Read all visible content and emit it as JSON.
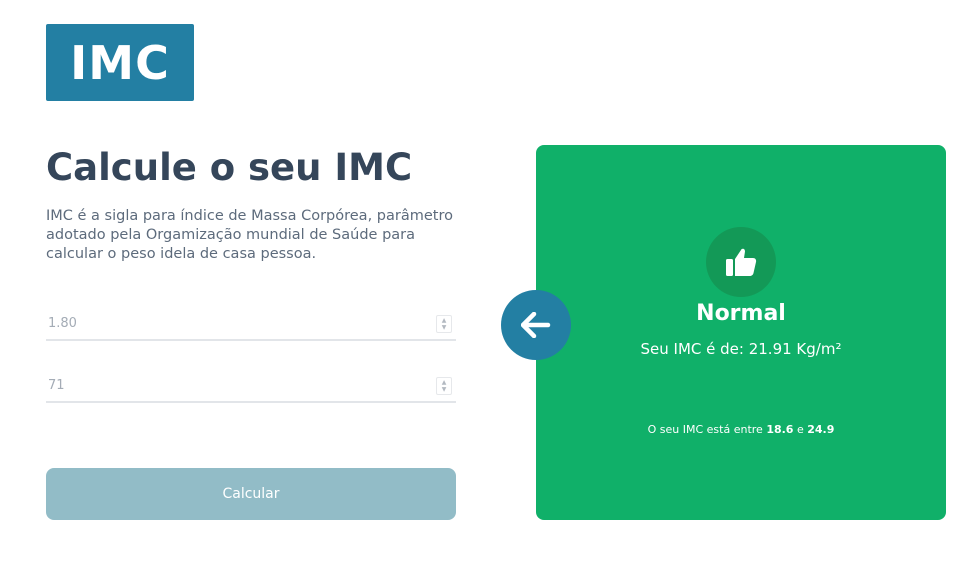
{
  "logo": {
    "text": "IMC"
  },
  "header": {
    "title": "Calcule o seu IMC",
    "description": "IMC é a sigla para índice de Massa Corpórea, parâmetro adotado pela Orgamização mundial de Saúde para calcular o peso idela de casa pessoa."
  },
  "form": {
    "height_placeholder": "1.80",
    "weight_placeholder": "71",
    "submit_label": "Calcular"
  },
  "result": {
    "status": "Normal",
    "value_text": "Seu IMC é de: 21.91 Kg/m²",
    "range_prefix": "O seu IMC está entre",
    "range_min": "18.6",
    "range_joiner": "e",
    "range_max": "24.9",
    "icon": "thumbs-up-icon"
  },
  "back_button": {
    "icon": "arrow-left-icon"
  },
  "colors": {
    "primary": "#237fa3",
    "success": "#10b069",
    "success_dark": "#139957",
    "button_disabled": "#92bcc7",
    "heading": "#35465a",
    "text": "#5d6b7c"
  }
}
